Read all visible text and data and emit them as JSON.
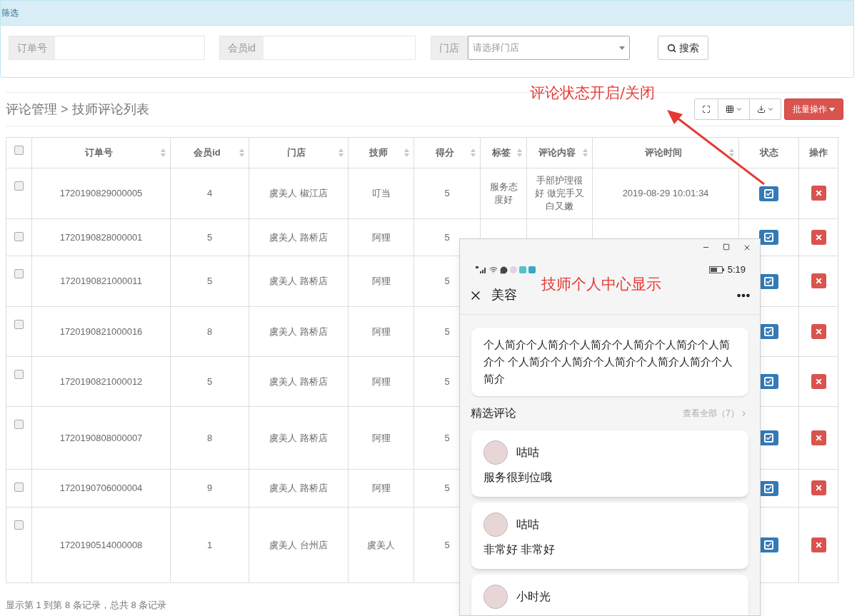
{
  "filter": {
    "title": "筛选",
    "fields": [
      {
        "label": "订单号"
      },
      {
        "label": "会员id"
      }
    ],
    "store_select": {
      "label": "门店",
      "placeholder": "请选择门店"
    },
    "search_button": "搜索"
  },
  "breadcrumb": "评论管理 > 技师评论列表",
  "batch_button": "批量操作",
  "annotations": [
    {
      "text": "评论状态开启/关闭"
    },
    {
      "text": "技师个人中心显示"
    }
  ],
  "table": {
    "all_checked": false,
    "columns": [
      {
        "label": "订单号",
        "sortable": true
      },
      {
        "label": "会员id",
        "sortable": true
      },
      {
        "label": "门店",
        "sortable": true
      },
      {
        "label": "技师",
        "sortable": true
      },
      {
        "label": "得分",
        "sortable": true
      },
      {
        "label": "标签",
        "sortable": true
      },
      {
        "label": "评论内容",
        "sortable": true
      },
      {
        "label": "评论时间",
        "sortable": true
      },
      {
        "label": "状态",
        "sortable": false
      },
      {
        "label": "操作",
        "sortable": false
      }
    ],
    "rows": [
      {
        "checked": false,
        "order": "1720190829000005",
        "member": "4",
        "store": "虞美人 椒江店",
        "tech": "叮当",
        "score": "5",
        "tag": "服务态度好",
        "content": "手部护理很好 做完手又白又嫩",
        "time": "2019-08-29 10:01:34",
        "enabled": true
      },
      {
        "checked": false,
        "order": "1720190828000001",
        "member": "5",
        "store": "虞美人 路桥店",
        "tech": "阿狸",
        "score": "5",
        "enabled": true
      },
      {
        "checked": false,
        "order": "1720190821000011",
        "member": "5",
        "store": "虞美人 路桥店",
        "tech": "阿狸",
        "score": "5",
        "enabled": true
      },
      {
        "checked": false,
        "order": "1720190821000016",
        "member": "8",
        "store": "虞美人 路桥店",
        "tech": "阿狸",
        "score": "5",
        "enabled": true
      },
      {
        "checked": false,
        "order": "1720190821000012",
        "member": "5",
        "store": "虞美人 路桥店",
        "tech": "阿狸",
        "score": "5",
        "enabled": true
      },
      {
        "checked": false,
        "order": "1720190808000007",
        "member": "8",
        "store": "虞美人 路桥店",
        "tech": "阿狸",
        "score": "5",
        "enabled": true
      },
      {
        "checked": false,
        "order": "1720190706000004",
        "member": "9",
        "store": "虞美人 路桥店",
        "tech": "阿狸",
        "score": "5",
        "enabled": true
      },
      {
        "checked": false,
        "order": "1720190514000008",
        "member": "1",
        "store": "虞美人 台州店",
        "tech": "虞美人",
        "score": "5",
        "enabled": true
      }
    ]
  },
  "pagination_info": "显示第 1 到第 8 条记录，总共 8 条记录",
  "phone": {
    "clock": "5:19",
    "title": "美容",
    "bio": "个人简介个人简介个人简介个人简介个人简介个人简介个 个人简介个人简介个人简介个人简介人简介个人简介",
    "section_title": "精选评论",
    "view_all": "查看全部（7）",
    "reviews": [
      {
        "name": "咕咕",
        "text": "服务很到位哦"
      },
      {
        "name": "咕咕",
        "text": "非常好 非常好"
      },
      {
        "name": "小时光"
      }
    ]
  }
}
